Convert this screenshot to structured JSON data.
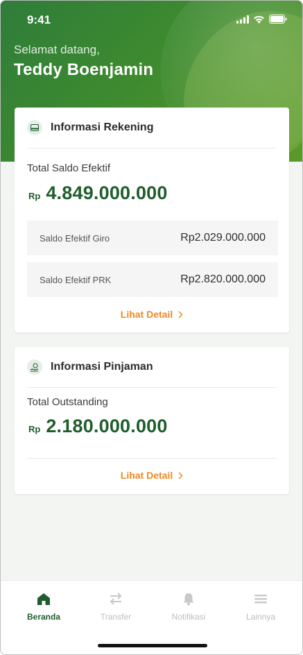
{
  "status_bar": {
    "time": "9:41"
  },
  "header": {
    "greeting": "Selamat datang,",
    "user_name": "Teddy Boenjamin"
  },
  "account_info": {
    "title": "Informasi Rekening",
    "icon": "card-icon",
    "total_label": "Total Saldo Efektif",
    "currency": "Rp",
    "total_value": "4.849.000.000",
    "rows": [
      {
        "label": "Saldo Efektif Giro",
        "value": "Rp2.029.000.000"
      },
      {
        "label": "Saldo Efektif PRK",
        "value": "Rp2.820.000.000"
      }
    ],
    "detail_link": "Lihat Detail"
  },
  "loan_info": {
    "title": "Informasi Pinjaman",
    "icon": "hand-money-icon",
    "total_label": "Total Outstanding",
    "currency": "Rp",
    "total_value": "2.180.000.000",
    "detail_link": "Lihat Detail"
  },
  "tabbar": {
    "items": [
      {
        "label": "Beranda",
        "icon": "home-icon",
        "active": true
      },
      {
        "label": "Transfer",
        "icon": "transfer-icon",
        "active": false
      },
      {
        "label": "Notifikasi",
        "icon": "bell-icon",
        "active": false
      },
      {
        "label": "Lainnya",
        "icon": "menu-icon",
        "active": false
      }
    ]
  },
  "colors": {
    "primary": "#1f5e2c",
    "accent": "#ef8a22",
    "header_bg": "#3d8a2f"
  }
}
